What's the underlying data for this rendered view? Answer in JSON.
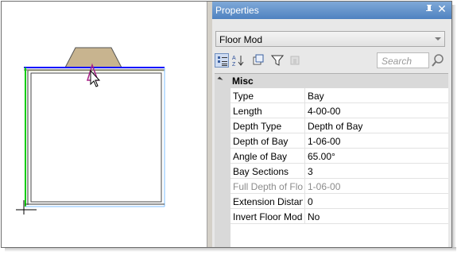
{
  "panel": {
    "title": "Properties",
    "pin_icon": "pin-icon",
    "close_icon": "close-icon",
    "selector_value": "Floor Mod",
    "search_placeholder": "Search"
  },
  "toolbar": {
    "buttons": [
      {
        "name": "categorized-icon",
        "active": true
      },
      {
        "name": "sort-alphabetical-icon",
        "active": false
      },
      {
        "name": "property-pages-icon",
        "active": false
      },
      {
        "name": "filter-icon",
        "active": false
      },
      {
        "name": "disabled-action-icon",
        "active": false
      }
    ]
  },
  "grid": {
    "category": "Misc",
    "rows": [
      {
        "name": "Type",
        "value": "Bay",
        "disabled": false
      },
      {
        "name": "Length",
        "value": "4-00-00",
        "disabled": false
      },
      {
        "name": "Depth Type",
        "value": "Depth of Bay",
        "disabled": false
      },
      {
        "name": "Depth of Bay",
        "value": "1-06-00",
        "disabled": false
      },
      {
        "name": "Angle of Bay",
        "value": "65.00°",
        "disabled": false
      },
      {
        "name": "Bay Sections",
        "value": "3",
        "disabled": false
      },
      {
        "name": "Full Depth of Floor",
        "value": "1-06-00",
        "disabled": true
      },
      {
        "name": "Extension Distance",
        "value": "0",
        "disabled": false
      },
      {
        "name": "Invert Floor Mod",
        "value": "No",
        "disabled": false
      }
    ]
  },
  "colors": {
    "title_bar": "#4f82c0",
    "bay_fill": "#c8b48f",
    "wall_blue": "#0000ff",
    "wall_green": "#00cc00"
  }
}
